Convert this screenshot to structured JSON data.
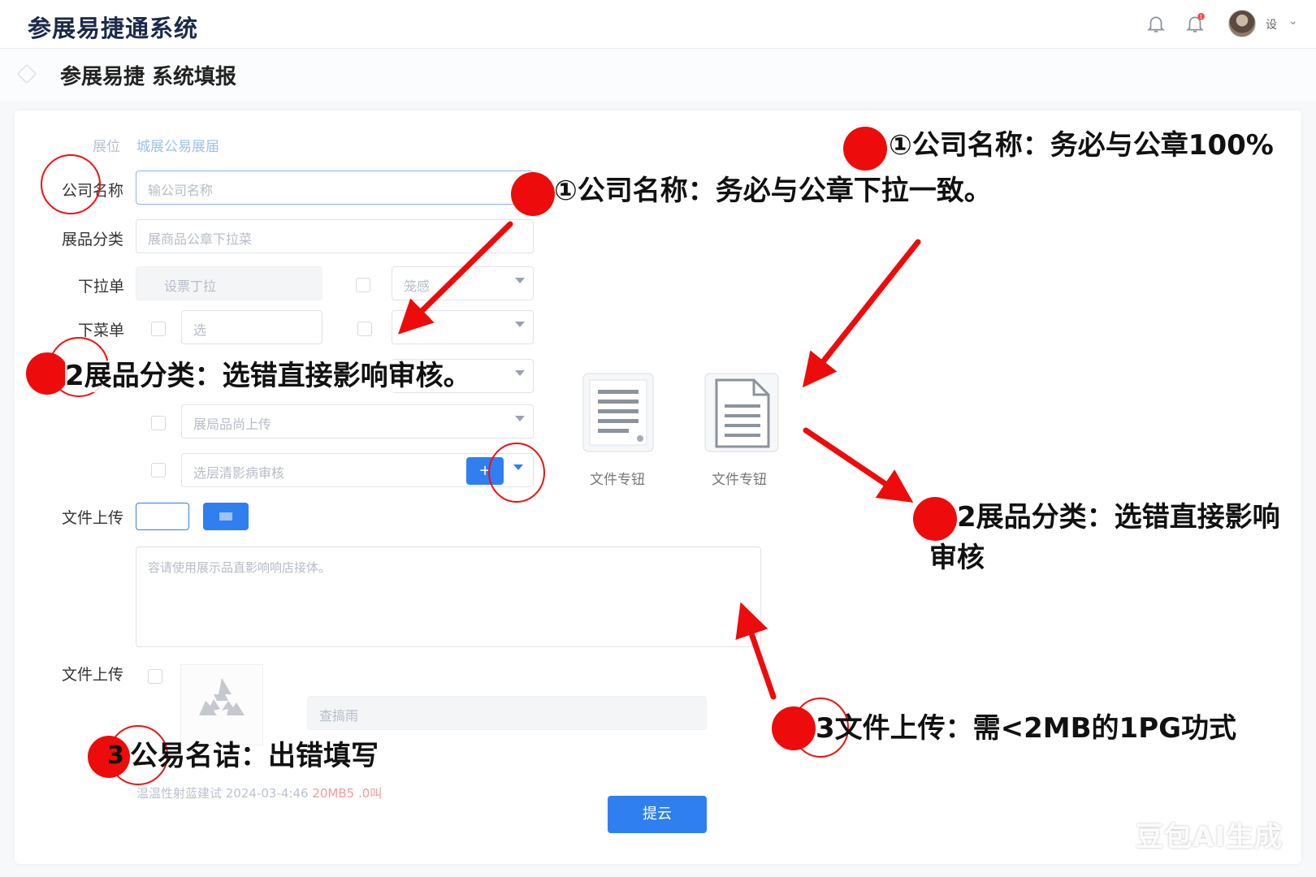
{
  "header": {
    "app_title": "参展易捷通系统",
    "user_name": "设",
    "notification_badge": "1"
  },
  "subheader": {
    "title": "参展易捷 系统填报"
  },
  "form": {
    "top_faint_label": "展位",
    "top_faint_value": "城展公易展届",
    "company_label": "公司名称",
    "company_placeholder": "输公司名称",
    "category_label": "展品分类",
    "category_placeholder": "展商品公章下拉菜",
    "dropdown_label": "下拉单",
    "dropdown_grey_value": "设票丁拉",
    "dropdown_select_value": "笼感",
    "menu_label": "下菜单",
    "menu_input_value": "选",
    "row6_select_value": "展局品尚上传",
    "row7_input_value": "选层清影病审核",
    "row7_button_label": "+",
    "upload_label": "文件上传",
    "textarea_placeholder": "容请使用展示品直影响响店接体。",
    "upload2_label": "文件上传",
    "upload2_input_placeholder": "查搞雨",
    "footer_note": "温温性射蓝建试 2024-03-4:46",
    "footer_note_red": "20MB5 .0叫",
    "submit_label": "提云",
    "file_card_1_label": "文件专钮",
    "file_card_2_label": "文件专钮"
  },
  "annotations": {
    "a1_top": "①公司名称：务必与公章100%",
    "a1_mid": "①公司名称：务必与公章下拉一致。",
    "a2_left": "2展品分类：选错直接影响审核。",
    "a2_right_line1": "2展品分类：选错直接影响",
    "a2_right_line2": "审核",
    "a3_right": "3文件上传：需<2MB的1PG功式",
    "a3_left": "公易名诘：出错填写",
    "a3_left_num": "3",
    "accent_color": "#ee0b0b"
  },
  "watermark": "豆包AI生成"
}
